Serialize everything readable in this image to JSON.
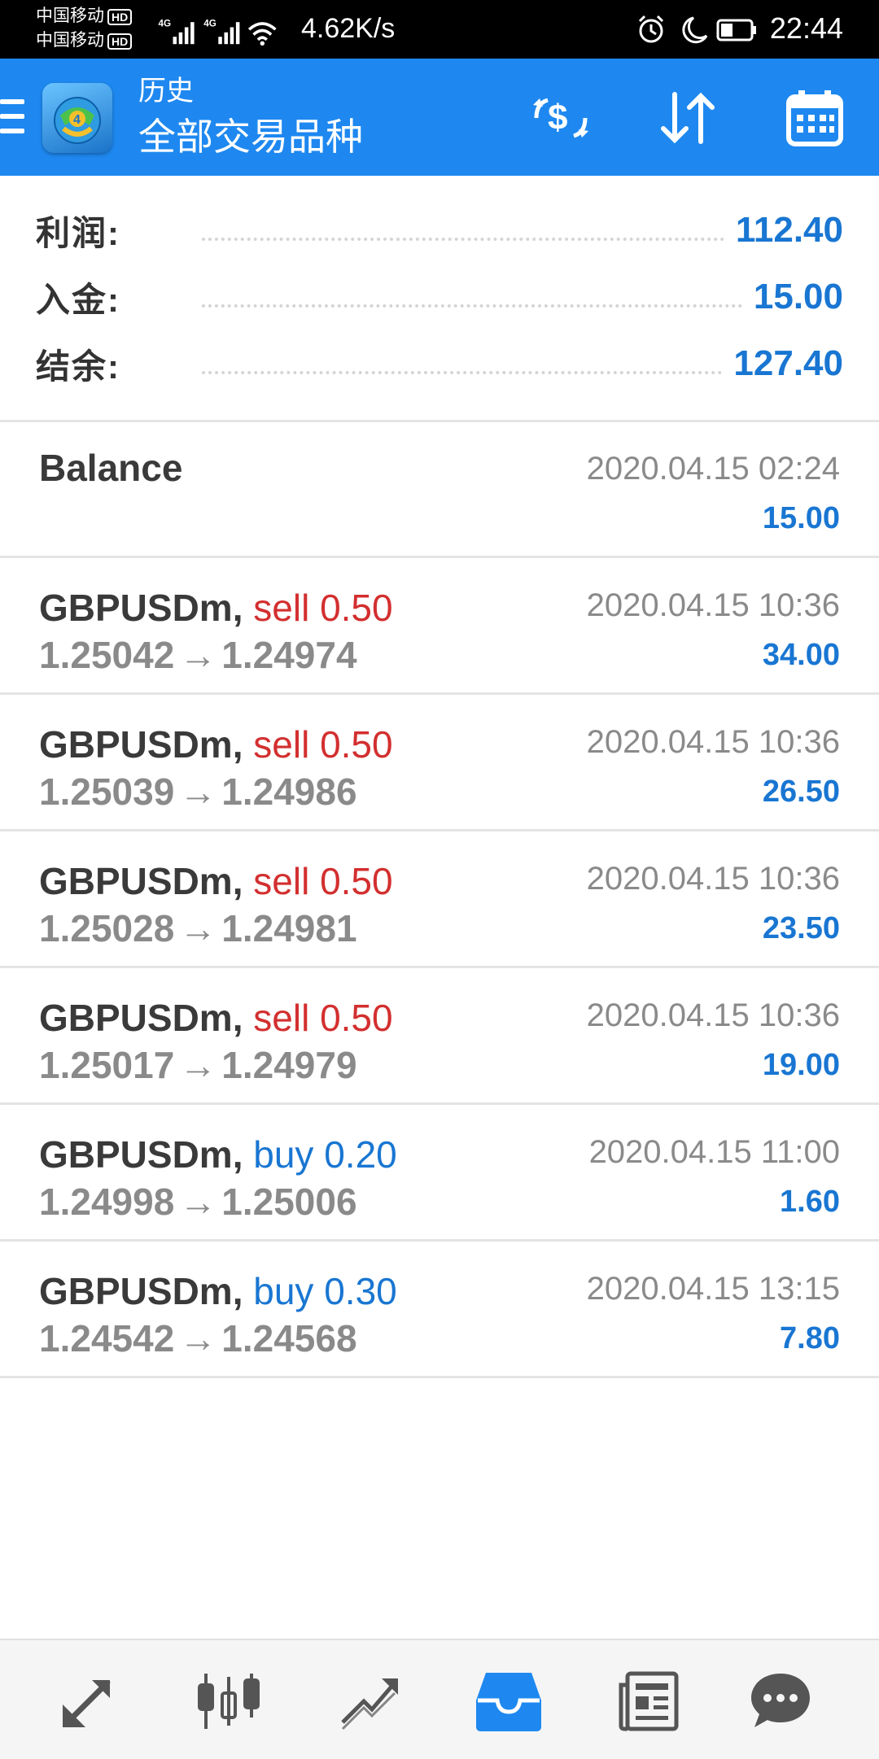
{
  "status_bar": {
    "carrier1": "中国移动",
    "carrier2": "中国移动",
    "hd_badge": "HD",
    "network_type": "4G",
    "net_speed": "4.62K/s",
    "time": "22:44",
    "icons": [
      "alarm-icon",
      "moon-icon",
      "battery-icon"
    ]
  },
  "app_bar": {
    "title": "历史",
    "subtitle": "全部交易品种",
    "actions": [
      "currency-exchange-icon",
      "sort-icon",
      "calendar-icon"
    ]
  },
  "summary": {
    "rows": [
      {
        "label": "利润:",
        "value": "112.40"
      },
      {
        "label": "入金:",
        "value": "15.00"
      },
      {
        "label": "结余:",
        "value": "127.40"
      }
    ]
  },
  "history": [
    {
      "type": "balance",
      "title": "Balance",
      "time": "2020.04.15 02:24",
      "amount": "15.00"
    },
    {
      "type": "trade",
      "symbol": "GBPUSDm,",
      "side": "sell 0.50",
      "open": "1.25042",
      "arrow": "→",
      "close": "1.24974",
      "time": "2020.04.15 10:36",
      "amount": "34.00"
    },
    {
      "type": "trade",
      "symbol": "GBPUSDm,",
      "side": "sell 0.50",
      "open": "1.25039",
      "arrow": "→",
      "close": "1.24986",
      "time": "2020.04.15 10:36",
      "amount": "26.50"
    },
    {
      "type": "trade",
      "symbol": "GBPUSDm,",
      "side": "sell 0.50",
      "open": "1.25028",
      "arrow": "→",
      "close": "1.24981",
      "time": "2020.04.15 10:36",
      "amount": "23.50"
    },
    {
      "type": "trade",
      "symbol": "GBPUSDm,",
      "side": "sell 0.50",
      "open": "1.25017",
      "arrow": "→",
      "close": "1.24979",
      "time": "2020.04.15 10:36",
      "amount": "19.00"
    },
    {
      "type": "trade",
      "symbol": "GBPUSDm,",
      "side": "buy 0.20",
      "open": "1.24998",
      "arrow": "→",
      "close": "1.25006",
      "time": "2020.04.15 11:00",
      "amount": "1.60"
    },
    {
      "type": "trade",
      "symbol": "GBPUSDm,",
      "side": "buy 0.30",
      "open": "1.24542",
      "arrow": "→",
      "close": "1.24568",
      "time": "2020.04.15 13:15",
      "amount": "7.80"
    }
  ],
  "bottom_nav": {
    "items": [
      "quotes-icon",
      "chart-icon",
      "trade-icon",
      "history-icon",
      "news-icon",
      "chat-icon"
    ],
    "active": "history-icon"
  },
  "colors": {
    "accent": "#1e88f0",
    "value_blue": "#1976d2",
    "sell_red": "#d32f2f",
    "nav_icon": "#555555"
  }
}
